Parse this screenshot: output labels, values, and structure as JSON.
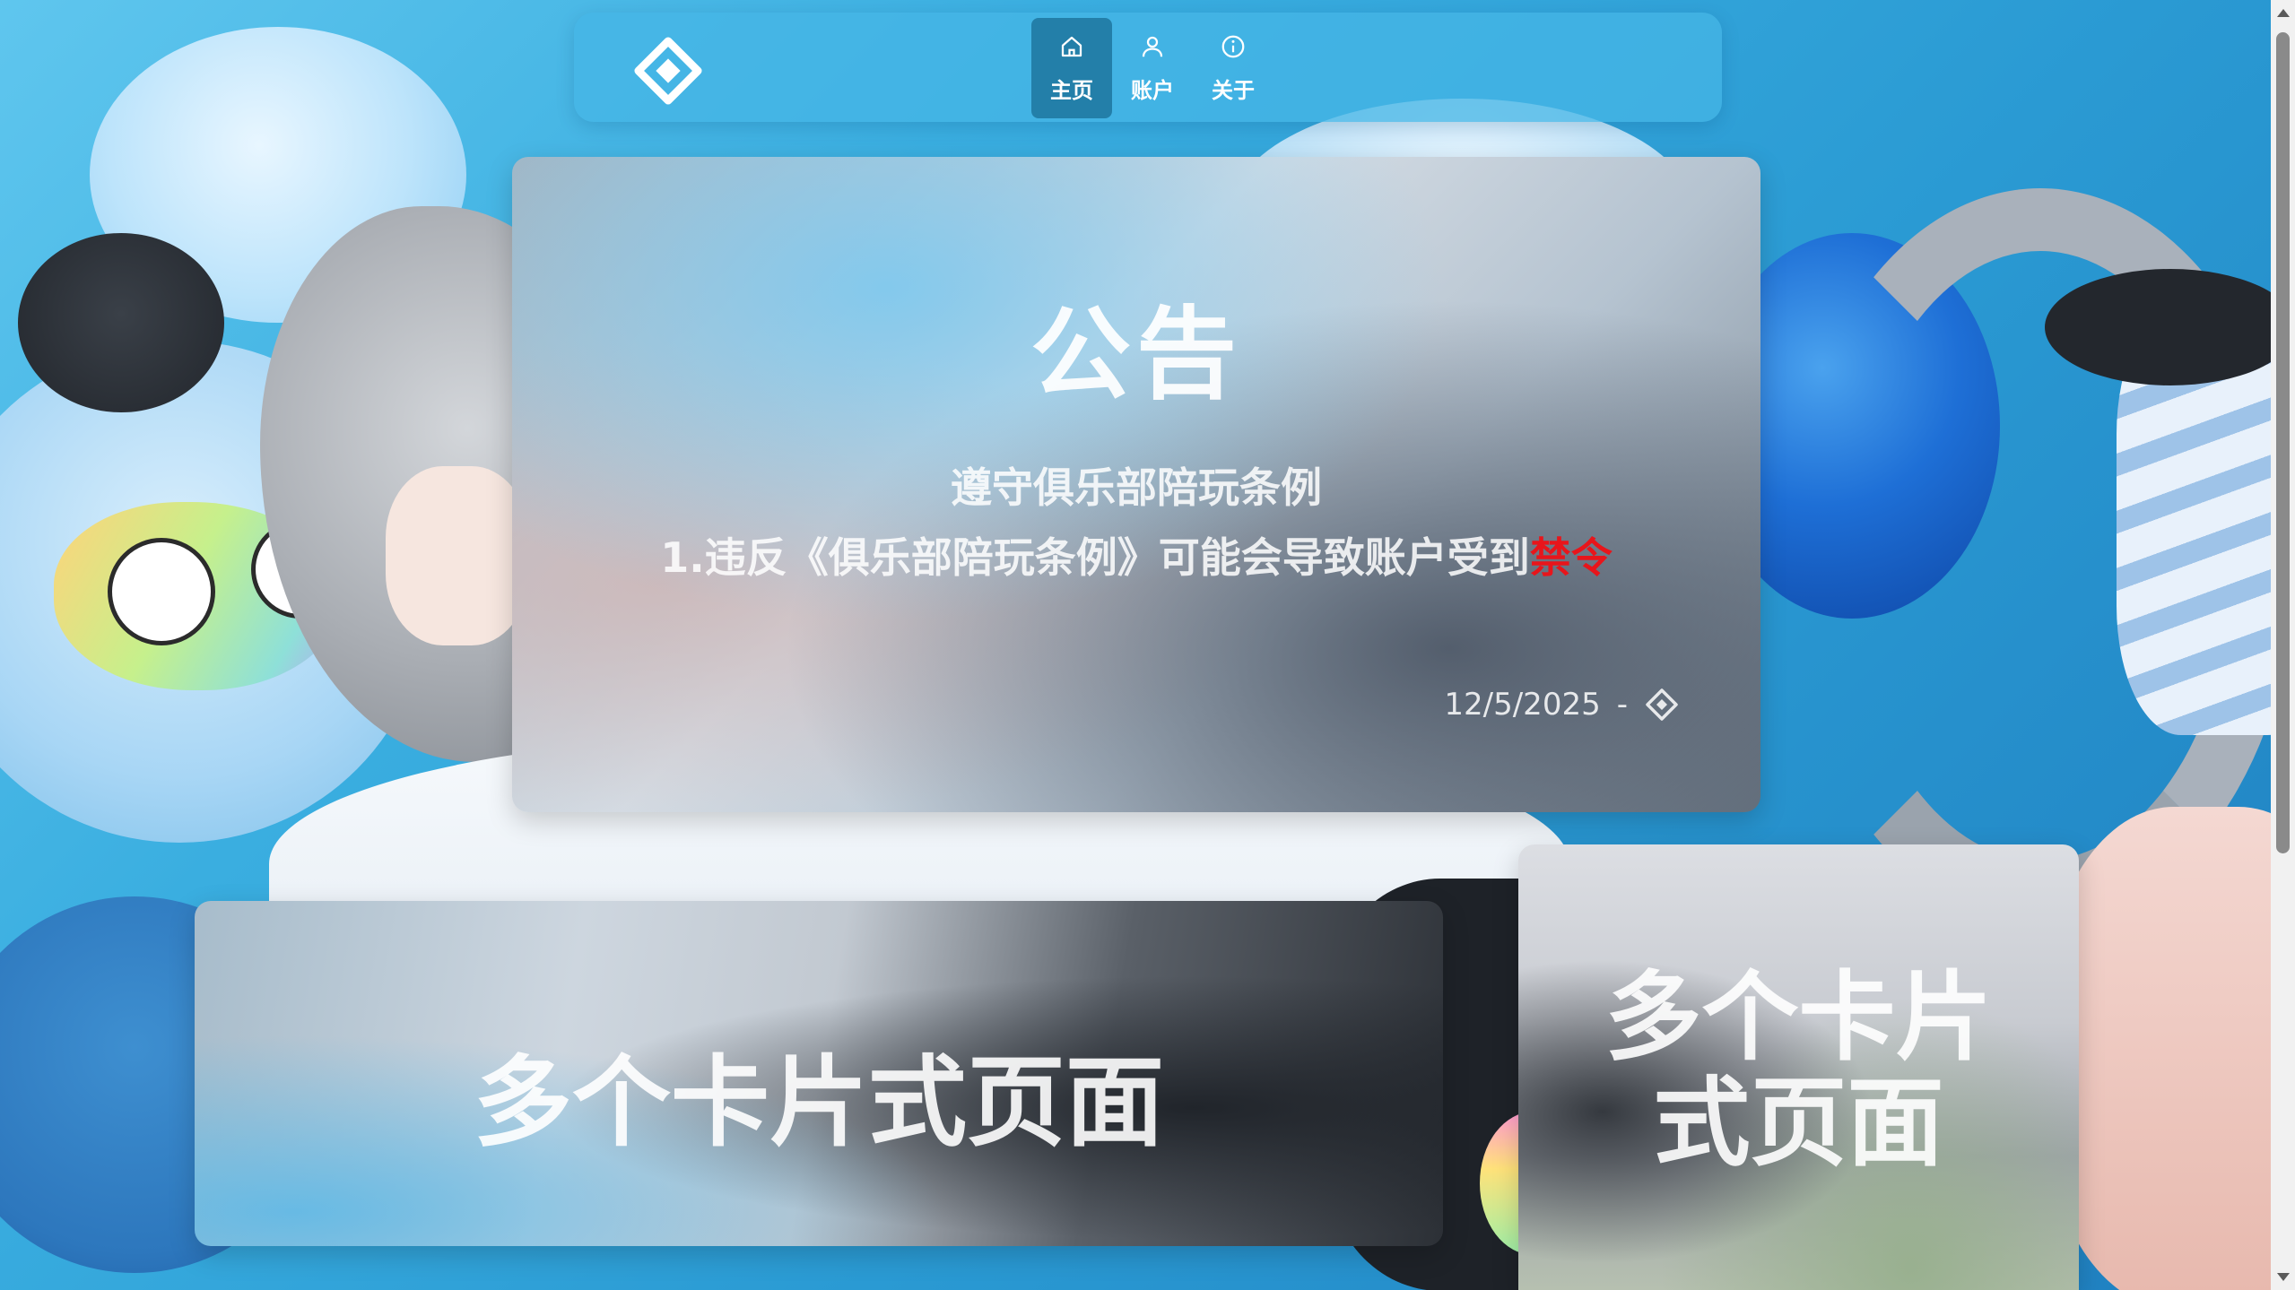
{
  "nav": {
    "items": [
      {
        "label": "主页",
        "icon": "home-icon",
        "active": true
      },
      {
        "label": "账户",
        "icon": "user-icon",
        "active": false
      },
      {
        "label": "关于",
        "icon": "info-icon",
        "active": false
      }
    ]
  },
  "announcement": {
    "title": "公告",
    "line1": "遵守俱乐部陪玩条例",
    "line2_prefix": "1.违反《俱乐部陪玩条例》可能会导致账户受到",
    "line2_emphasis": "禁令",
    "date": "12/5/2025",
    "separator": "-",
    "emphasis_color": "#e8151b"
  },
  "cards": {
    "wide_text": "多个卡片式页面",
    "tall_text": "多个卡片式页面"
  },
  "colors": {
    "nav_bg": "#46b6e6",
    "nav_active": "#196e96",
    "accent": "#3aaee0"
  }
}
